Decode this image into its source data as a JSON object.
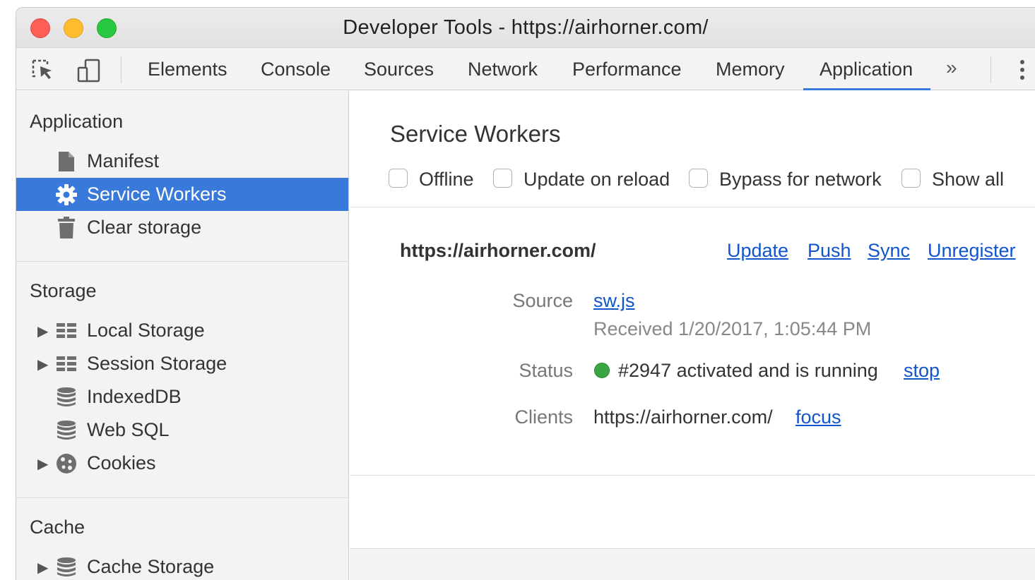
{
  "window": {
    "title": "Developer Tools - https://airhorner.com/"
  },
  "toolbar": {
    "tabs": [
      "Elements",
      "Console",
      "Sources",
      "Network",
      "Performance",
      "Memory",
      "Application"
    ],
    "active_tab": "Application",
    "more_label": "»",
    "icons": [
      "inspect-element-icon",
      "device-toolbar-icon",
      "kebab-menu-icon"
    ]
  },
  "sidebar": {
    "application": {
      "title": "Application",
      "items": [
        "Manifest",
        "Service Workers",
        "Clear storage"
      ],
      "selected": "Service Workers"
    },
    "storage": {
      "title": "Storage",
      "items": [
        "Local Storage",
        "Session Storage",
        "IndexedDB",
        "Web SQL",
        "Cookies"
      ]
    },
    "cache": {
      "title": "Cache",
      "items": [
        "Cache Storage"
      ]
    }
  },
  "main": {
    "title": "Service Workers",
    "options": [
      "Offline",
      "Update on reload",
      "Bypass for network",
      "Show all"
    ],
    "worker": {
      "origin": "https://airhorner.com/",
      "actions": [
        "Update",
        "Push",
        "Sync",
        "Unregister"
      ],
      "source_label": "Source",
      "source_file": "sw.js",
      "received": "Received 1/20/2017, 1:05:44 PM",
      "status_label": "Status",
      "status_text": "#2947 activated and is running",
      "status_action": "stop",
      "status_color": "#3aa543",
      "clients_label": "Clients",
      "clients_value": "https://airhorner.com/",
      "clients_action": "focus"
    }
  },
  "colors": {
    "accent": "#3879d9",
    "link": "#1155cc"
  }
}
